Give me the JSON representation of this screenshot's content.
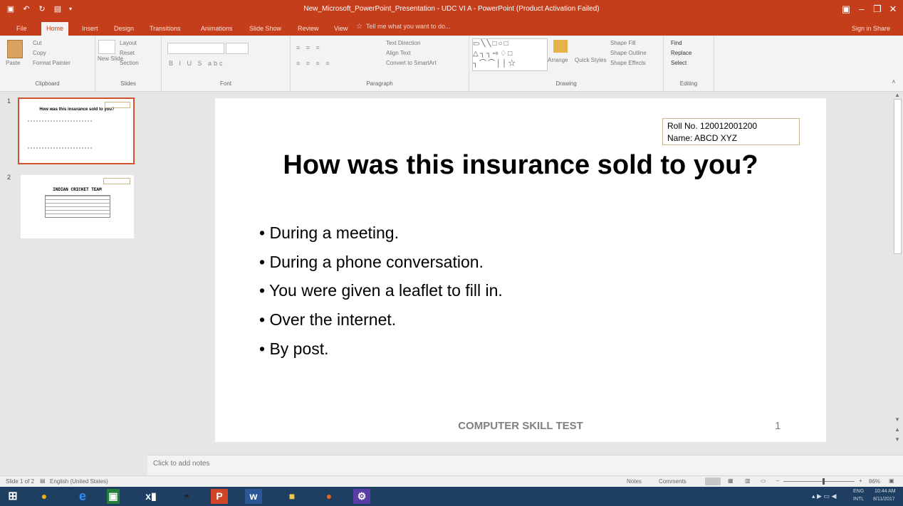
{
  "window": {
    "title": "New_Microsoft_PowerPoint_Presentation - UDC VI A - PowerPoint (Product Activation Failed)",
    "sign_in": "Sign in",
    "share": "Share"
  },
  "ribbon_tabs": [
    "File",
    "Home",
    "Insert",
    "Design",
    "Transitions",
    "Animations",
    "Slide Show",
    "Review",
    "View"
  ],
  "tell_me": "Tell me what you want to do...",
  "ribbon": {
    "clipboard": {
      "paste": "Paste",
      "cut": "Cut",
      "copy": "Copy",
      "format_painter": "Format Painter",
      "label": "Clipboard"
    },
    "slides": {
      "new_slide": "New Slide",
      "layout": "Layout",
      "reset": "Reset",
      "section": "Section",
      "label": "Slides"
    },
    "font": {
      "label": "Font"
    },
    "paragraph": {
      "text_direction": "Text Direction",
      "align_text": "Align Text",
      "convert_smartart": "Convert to SmartArt",
      "label": "Paragraph"
    },
    "drawing": {
      "arrange": "Arrange",
      "quick_styles": "Quick Styles",
      "shape_fill": "Shape Fill",
      "shape_outline": "Shape Outline",
      "shape_effects": "Shape Effects",
      "label": "Drawing"
    },
    "editing": {
      "find": "Find",
      "replace": "Replace",
      "select": "Select",
      "label": "Editing"
    }
  },
  "thumbnails": [
    {
      "number": "1",
      "title": "How was this insurance sold to you?"
    },
    {
      "number": "2",
      "title": "INDIAN CRICKET TEAM"
    }
  ],
  "slide": {
    "roll_no": "Roll No.  120012001200",
    "name": "Name: ABCD XYZ",
    "title": "How was this insurance sold to you?",
    "bullets": [
      "During a meeting.",
      "During a phone conversation.",
      "You were given a leaflet to fill in.",
      "Over the internet.",
      "By post."
    ],
    "footer": "COMPUTER SKILL TEST",
    "number": "1"
  },
  "notes_placeholder": "Click to add notes",
  "status": {
    "slide_count": "Slide 1 of 2",
    "language": "English (United States)",
    "notes": "Notes",
    "comments": "Comments",
    "zoom": "86%"
  },
  "taskbar": {
    "time": "10:44 AM",
    "date": "8/11/2017",
    "lang": "ENG",
    "region": "INTL"
  },
  "colors": {
    "accent": "#c43e1c",
    "taskbar": "#1e3e62"
  }
}
